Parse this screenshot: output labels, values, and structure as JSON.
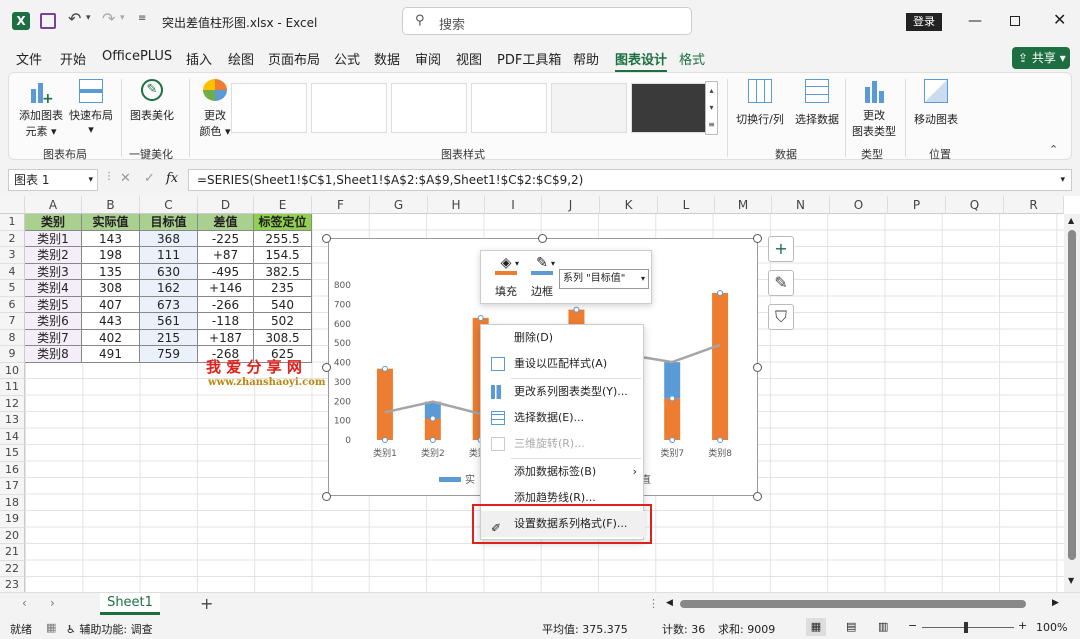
{
  "titlebar": {
    "filename": "突出差值柱形图.xlsx",
    "sep": " - ",
    "app": "Excel",
    "search_placeholder": "搜索",
    "login": "登录"
  },
  "menu": [
    "文件",
    "开始",
    "OfficePLUS",
    "插入",
    "绘图",
    "页面布局",
    "公式",
    "数据",
    "审阅",
    "视图",
    "PDF工具箱",
    "帮助",
    "图表设计",
    "格式"
  ],
  "share": "共享",
  "ribbon": {
    "add_element": "添加图表",
    "add_element2": "元素",
    "quick_layout": "快速布局",
    "beautify": "图表美化",
    "change_color": "更改",
    "change_color2": "颜色",
    "switch_rowcol": "切换行/列",
    "select_data": "选择数据",
    "change_type": "更改",
    "change_type2": "图表类型",
    "move_chart": "移动图表",
    "groups": {
      "layout": "图表布局",
      "beautify": "一键美化",
      "styles": "图表样式",
      "data": "数据",
      "type": "类型",
      "location": "位置"
    }
  },
  "formula": {
    "namebox": "图表 1",
    "fx": "fx",
    "text": "=SERIES(Sheet1!$C$1,Sheet1!$A$2:$A$9,Sheet1!$C$2:$C$9,2)"
  },
  "columns": [
    "A",
    "B",
    "C",
    "D",
    "E",
    "F",
    "G",
    "H",
    "I",
    "J",
    "K",
    "L",
    "M",
    "N",
    "O",
    "P",
    "Q",
    "R"
  ],
  "table": {
    "headers": [
      "类别",
      "实际值",
      "目标值",
      "差值",
      "标签定位"
    ],
    "rows": [
      [
        "类别1",
        "143",
        "368",
        "-225",
        "255.5"
      ],
      [
        "类别2",
        "198",
        "111",
        "+87",
        "154.5"
      ],
      [
        "类别3",
        "135",
        "630",
        "-495",
        "382.5"
      ],
      [
        "类别4",
        "308",
        "162",
        "+146",
        "235"
      ],
      [
        "类别5",
        "407",
        "673",
        "-266",
        "540"
      ],
      [
        "类别6",
        "443",
        "561",
        "-118",
        "502"
      ],
      [
        "类别7",
        "402",
        "215",
        "+187",
        "308.5"
      ],
      [
        "类别8",
        "491",
        "759",
        "-268",
        "625"
      ]
    ]
  },
  "watermark": {
    "title": "我 爱 分 享 网",
    "url": "www.zhanshaoyi.com"
  },
  "chart_data": {
    "type": "bar",
    "categories": [
      "类别1",
      "类别2",
      "类别3",
      "类别4",
      "类别5",
      "类别6",
      "类别7",
      "类别8"
    ],
    "series": [
      {
        "name": "实际值",
        "values": [
          143,
          198,
          135,
          308,
          407,
          443,
          402,
          491
        ]
      },
      {
        "name": "目标值",
        "values": [
          368,
          111,
          630,
          162,
          673,
          561,
          215,
          759
        ]
      }
    ],
    "yticks": [
      "800",
      "700",
      "600",
      "500",
      "400",
      "300",
      "200",
      "100",
      "0"
    ],
    "ylim": [
      0,
      800
    ],
    "legend_partial": "实",
    "legend_tail": "直",
    "colors": {
      "orange": "#ED7D31",
      "blue": "#5B9BD5",
      "line": "#A5A5A5"
    }
  },
  "minitoolbar": {
    "fill": "填充",
    "border": "边框",
    "series_select": "系列 \"目标值\""
  },
  "context_menu": [
    "删除(D)",
    "重设以匹配样式(A)",
    "更改系列图表类型(Y)...",
    "选择数据(E)...",
    "三维旋转(R)...",
    "添加数据标签(B)",
    "添加趋势线(R)...",
    "设置数据系列格式(F)..."
  ],
  "sheet_tab": "Sheet1",
  "status": {
    "ready": "就绪",
    "accessibility": "辅助功能: 调查",
    "average": "平均值: 375.375",
    "count": "计数: 36",
    "sum": "求和: 9009",
    "zoom": "100%"
  }
}
